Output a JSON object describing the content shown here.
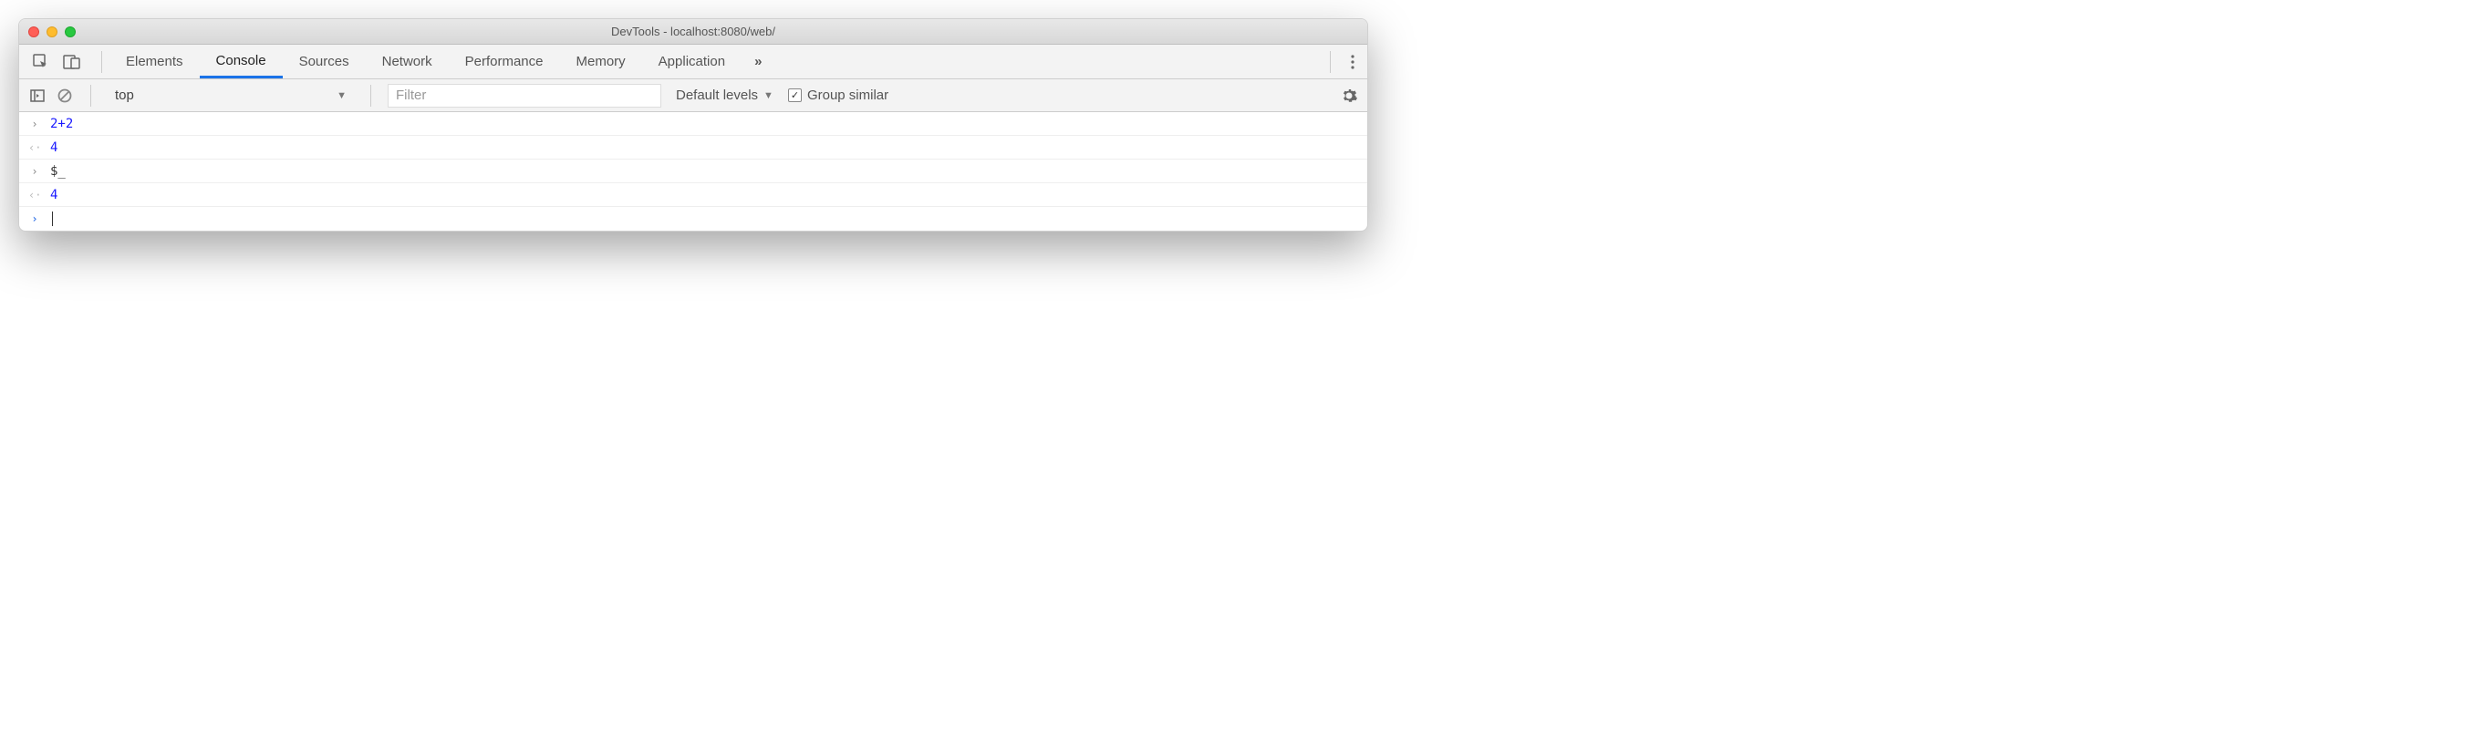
{
  "window": {
    "title": "DevTools - localhost:8080/web/"
  },
  "tabs": {
    "items": [
      "Elements",
      "Console",
      "Sources",
      "Network",
      "Performance",
      "Memory",
      "Application"
    ],
    "active": "Console"
  },
  "toolbar": {
    "context": "top",
    "filter_placeholder": "Filter",
    "levels_label": "Default levels",
    "group_similar_label": "Group similar",
    "group_similar_checked": true
  },
  "console": {
    "lines": [
      {
        "kind": "input",
        "text": "2+2"
      },
      {
        "kind": "output",
        "text": "4"
      },
      {
        "kind": "input",
        "text": "$_"
      },
      {
        "kind": "output",
        "text": "4"
      }
    ]
  }
}
